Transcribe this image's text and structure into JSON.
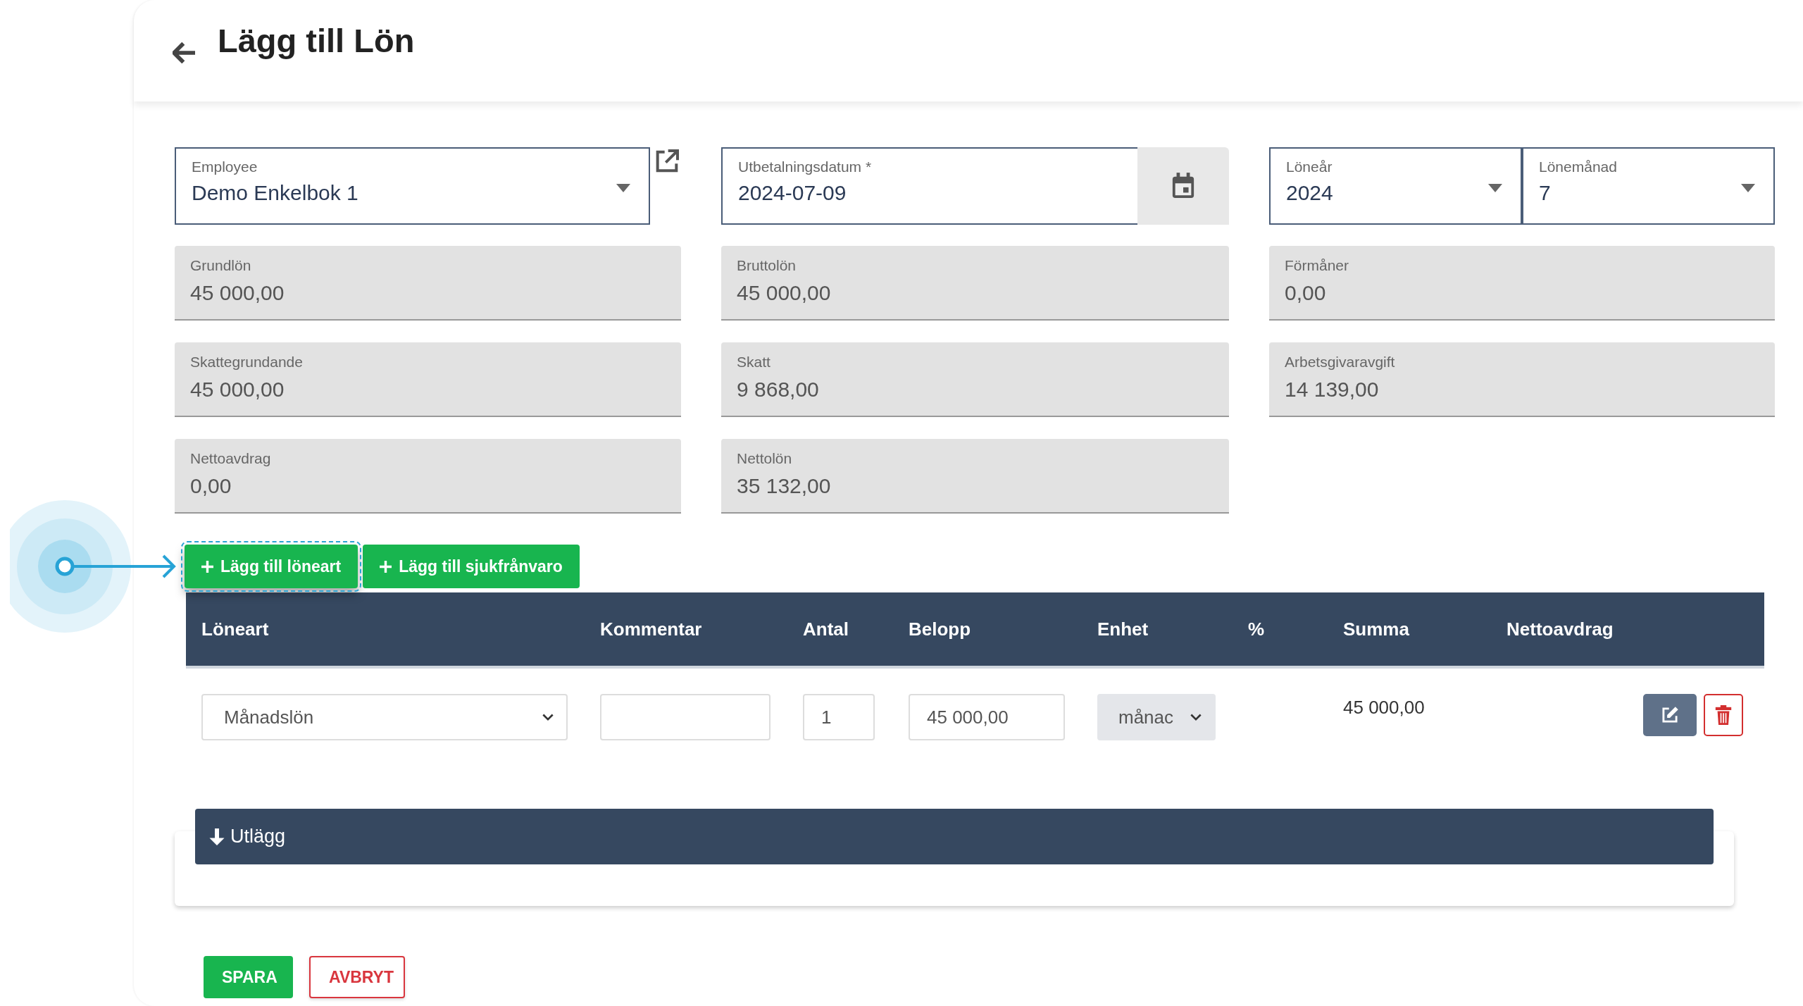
{
  "page": {
    "title": "Lägg till Lön"
  },
  "header_fields": {
    "employee": {
      "label": "Employee",
      "value": "Demo Enkelbok 1"
    },
    "payment_date": {
      "label": "Utbetalningsdatum *",
      "value": "2024-07-09"
    },
    "salary_year": {
      "label": "Löneår",
      "value": "2024"
    },
    "salary_month": {
      "label": "Lönemånad",
      "value": "7"
    }
  },
  "summary_fields": [
    {
      "label": "Grundlön",
      "value": "45 000,00"
    },
    {
      "label": "Bruttolön",
      "value": "45 000,00"
    },
    {
      "label": "Förmåner",
      "value": "0,00"
    },
    {
      "label": "Skattegrundande",
      "value": "45 000,00"
    },
    {
      "label": "Skatt",
      "value": "9 868,00"
    },
    {
      "label": "Arbetsgivaravgift",
      "value": "14 139,00"
    },
    {
      "label": "Nettoavdrag",
      "value": "0,00"
    },
    {
      "label": "Nettolön",
      "value": "35 132,00"
    }
  ],
  "add_buttons": [
    {
      "label": "Lägg till löneart",
      "focused": true
    },
    {
      "label": "Lägg till sjukfrånvaro",
      "focused": false
    }
  ],
  "table": {
    "columns": [
      "Löneart",
      "Kommentar",
      "Antal",
      "Belopp",
      "Enhet",
      "%",
      "Summa",
      "Nettoavdrag"
    ],
    "rows": [
      {
        "salary_type": "Månadslön",
        "quantity": "1",
        "amount": "45 000,00",
        "unit": {
          "value": "månac",
          "disabled": true
        },
        "sum": "45 000,00"
      }
    ]
  },
  "expenses_section": {
    "title": "Utlägg"
  },
  "footer_buttons": [
    {
      "kind": "primary",
      "label": "SPARA"
    },
    {
      "kind": "outline",
      "label": "AVBRYT"
    }
  ]
}
